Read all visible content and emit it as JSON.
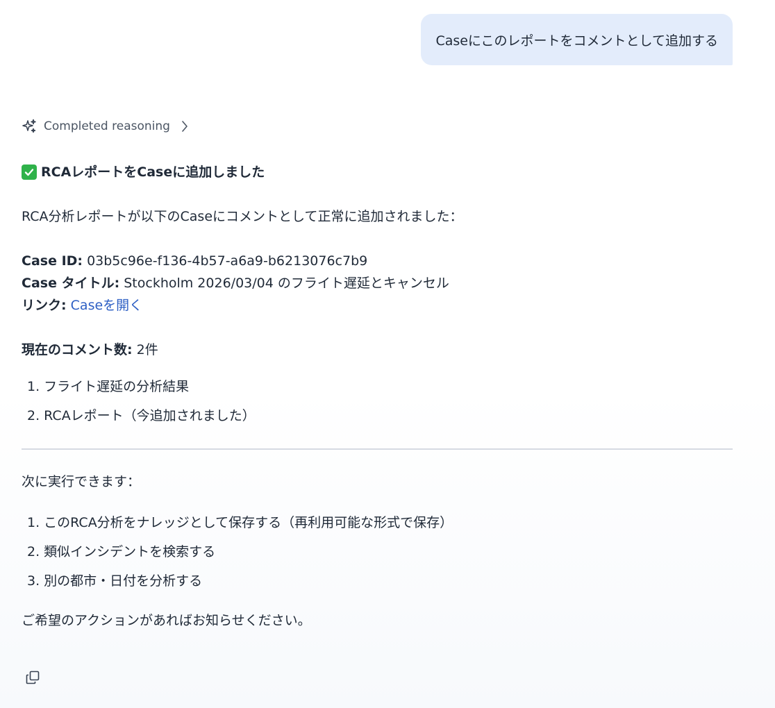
{
  "user_message": {
    "text": "Caseにこのレポートをコメントとして追加する"
  },
  "reasoning": {
    "icon": "sparkles-icon",
    "label": "Completed reasoning",
    "chevron_icon": "chevron-right-icon"
  },
  "answer": {
    "heading_icon": "check-mark-icon",
    "heading_icon_color": "#2fb24a",
    "heading": "RCAレポートをCaseに追加しました",
    "intro": "RCA分析レポートが以下のCaseにコメントとして正常に追加されました：",
    "case_id_label": "Case ID:",
    "case_id_value": "03b5c96e-f136-4b57-a6a9-b6213076c7b9",
    "case_title_label": "Case タイトル:",
    "case_title_value": "Stockholm 2026/03/04 のフライト遅延とキャンセル",
    "link_label": "リンク:",
    "link_text": "Caseを開く",
    "link_color": "#2d5fc4",
    "comment_count_label": "現在のコメント数:",
    "comment_count_value": "2件",
    "comments": [
      "1. フライト遅延の分析結果",
      "2. RCAレポート（今追加されました）"
    ],
    "next_intro": "次に実行できます：",
    "next_actions": [
      "1. このRCA分析をナレッジとして保存する（再利用可能な形式で保存）",
      "2. 類似インシデントを検索する",
      "3. 別の都市・日付を分析する"
    ],
    "closing": "ご希望のアクションがあればお知らせください。"
  },
  "toolbar": {
    "copy_icon": "copy-icon"
  }
}
